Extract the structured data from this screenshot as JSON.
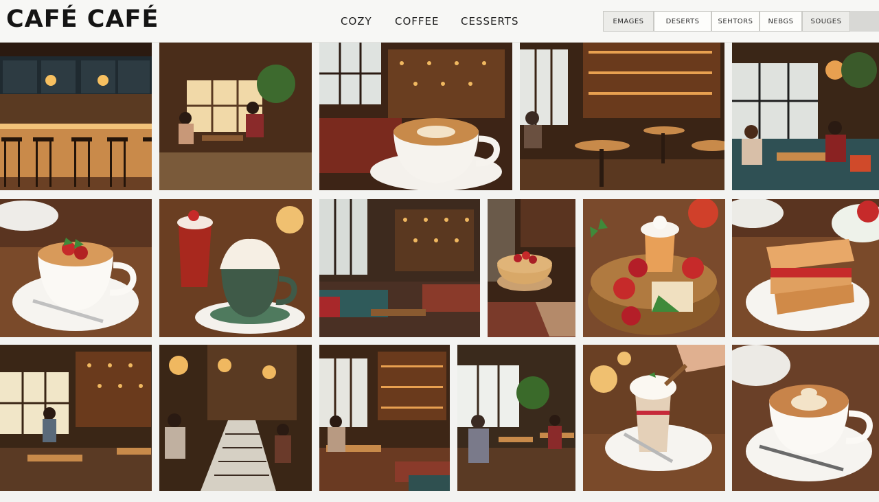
{
  "header": {
    "logo": "CAFÉ CAFÉ",
    "nav": [
      "COZY",
      "COFFEE",
      "CESSERTS"
    ],
    "filters": [
      "EMAGES",
      "DESERTS",
      "SEHTORS",
      "NEBGS",
      "SOUGES"
    ]
  },
  "colors": {
    "background": "#f3f3f1",
    "header": "#f7f7f5",
    "wood_dark": "#3a2215",
    "wood": "#7a4a28",
    "warm_light": "#f0b860",
    "cup_white": "#f6f3ee",
    "crema": "#c88a4a",
    "strawberry": "#c62a2a",
    "mint": "#3f8a3a",
    "cup_green": "#3f5a48"
  },
  "gallery": {
    "images": [
      {
        "name": "bar-counter-photo",
        "scene": "bar"
      },
      {
        "name": "couple-window-photo",
        "scene": "room"
      },
      {
        "name": "latte-lounge-photo",
        "scene": "latte-room"
      },
      {
        "name": "cafe-tables-photo",
        "scene": "room"
      },
      {
        "name": "couple-sofa-photo",
        "scene": "room"
      },
      {
        "name": "strawberry-cup-photo",
        "scene": "cup-berry"
      },
      {
        "name": "cream-cup-and-smoothie-photo",
        "scene": "cup-cream"
      },
      {
        "name": "lounge-sofas-photo",
        "scene": "lounge"
      },
      {
        "name": "fruit-tart-photo",
        "scene": "tart"
      },
      {
        "name": "fruit-basket-photo",
        "scene": "basket"
      },
      {
        "name": "sandwich-plate-photo",
        "scene": "sandwich"
      },
      {
        "name": "window-interior-photo",
        "scene": "room"
      },
      {
        "name": "patterned-floor-photo",
        "scene": "room"
      },
      {
        "name": "bookshelf-seating-photo",
        "scene": "room"
      },
      {
        "name": "busy-cafe-photo",
        "scene": "room"
      },
      {
        "name": "cream-dessert-glass-photo",
        "scene": "parfait"
      },
      {
        "name": "latte-art-cup-photo",
        "scene": "latte"
      }
    ]
  }
}
